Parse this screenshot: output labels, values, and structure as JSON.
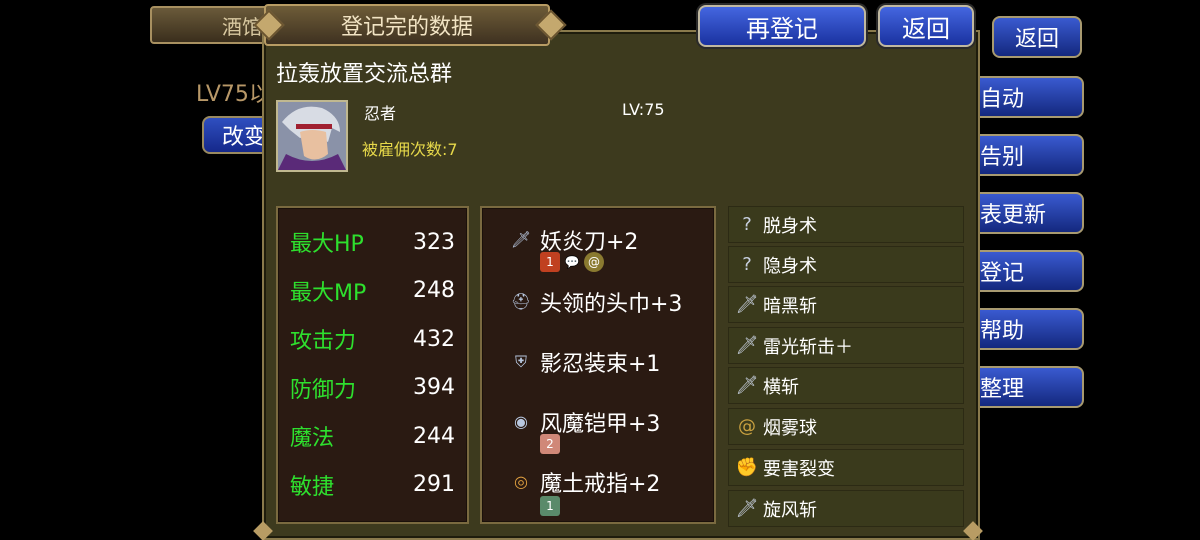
{
  "background": {
    "tab_label": "酒馆",
    "lv_text": "LV75以",
    "change_label": "改变",
    "side_buttons": [
      "返回",
      "自动",
      "告别",
      "表更新",
      "登记",
      "帮助",
      "整理"
    ]
  },
  "panel": {
    "title": "登记完的数据",
    "reregister_label": "再登记",
    "back_label": "返回",
    "group_name": "拉轰放置交流总群"
  },
  "character": {
    "job": "忍者",
    "level": "LV:75",
    "hire_count": "被雇佣次数:7"
  },
  "stats": [
    {
      "name": "最大HP",
      "value": "323"
    },
    {
      "name": "最大MP",
      "value": "248"
    },
    {
      "name": "攻击力",
      "value": "432"
    },
    {
      "name": "防御力",
      "value": "394"
    },
    {
      "name": "魔法",
      "value": "244"
    },
    {
      "name": "敏捷",
      "value": "291"
    }
  ],
  "equipment": [
    {
      "name": "妖炎刀+2",
      "icon": "sword-icon",
      "sub": [
        "1"
      ]
    },
    {
      "name": "头领的头巾+3",
      "icon": "helmet-icon",
      "sub": []
    },
    {
      "name": "影忍装束+1",
      "icon": "armor-icon",
      "sub": []
    },
    {
      "name": "风魔铠甲+3",
      "icon": "shield-icon",
      "sub": [
        "2"
      ]
    },
    {
      "name": "魔土戒指+2",
      "icon": "ring-icon",
      "sub": [
        "1"
      ]
    }
  ],
  "skills": [
    {
      "name": "脱身术",
      "icon": "question-icon"
    },
    {
      "name": "隐身术",
      "icon": "question-icon"
    },
    {
      "name": "暗黑斩",
      "icon": "sword-icon"
    },
    {
      "name": "雷光斩击＋",
      "icon": "sword-icon"
    },
    {
      "name": "横斩",
      "icon": "sword-icon"
    },
    {
      "name": "烟雾球",
      "icon": "smoke-icon"
    },
    {
      "name": "要害裂变",
      "icon": "fist-icon"
    },
    {
      "name": "旋风斩",
      "icon": "sword-icon"
    }
  ]
}
